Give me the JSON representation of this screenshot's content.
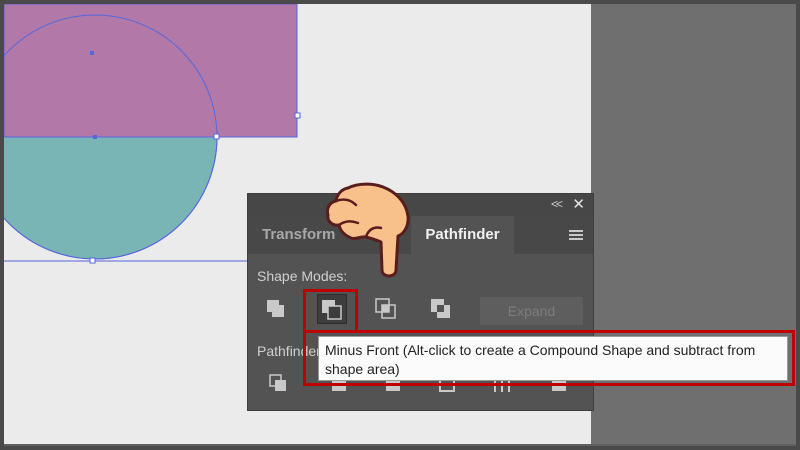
{
  "panel": {
    "tabs": [
      {
        "label": "Transform",
        "active": false
      },
      {
        "label": "Pathfinder",
        "active": true
      }
    ],
    "collapse_icon": "double-chevron-left-icon",
    "close_icon": "close-icon",
    "menu_icon": "hamburger-menu-icon",
    "shape_modes_label": "Shape Modes:",
    "shape_mode_buttons": [
      "unite",
      "minus-front",
      "intersect",
      "exclude"
    ],
    "active_shape_mode": "minus-front",
    "expand_label": "Expand",
    "pathfinders_label": "Pathfinders:",
    "pathfinder_buttons": [
      "divide",
      "trim",
      "merge",
      "crop",
      "outline",
      "minus-back"
    ]
  },
  "tooltip": {
    "text": "Minus Front (Alt-click to create a Compound Shape and subtract from shape area)"
  },
  "colors": {
    "rectangle_fill": "#b279a8",
    "circle_fill": "#7ab5b5",
    "selection": "#5566dd",
    "highlight": "#c00000",
    "hand_fill": "#f8c18c"
  }
}
